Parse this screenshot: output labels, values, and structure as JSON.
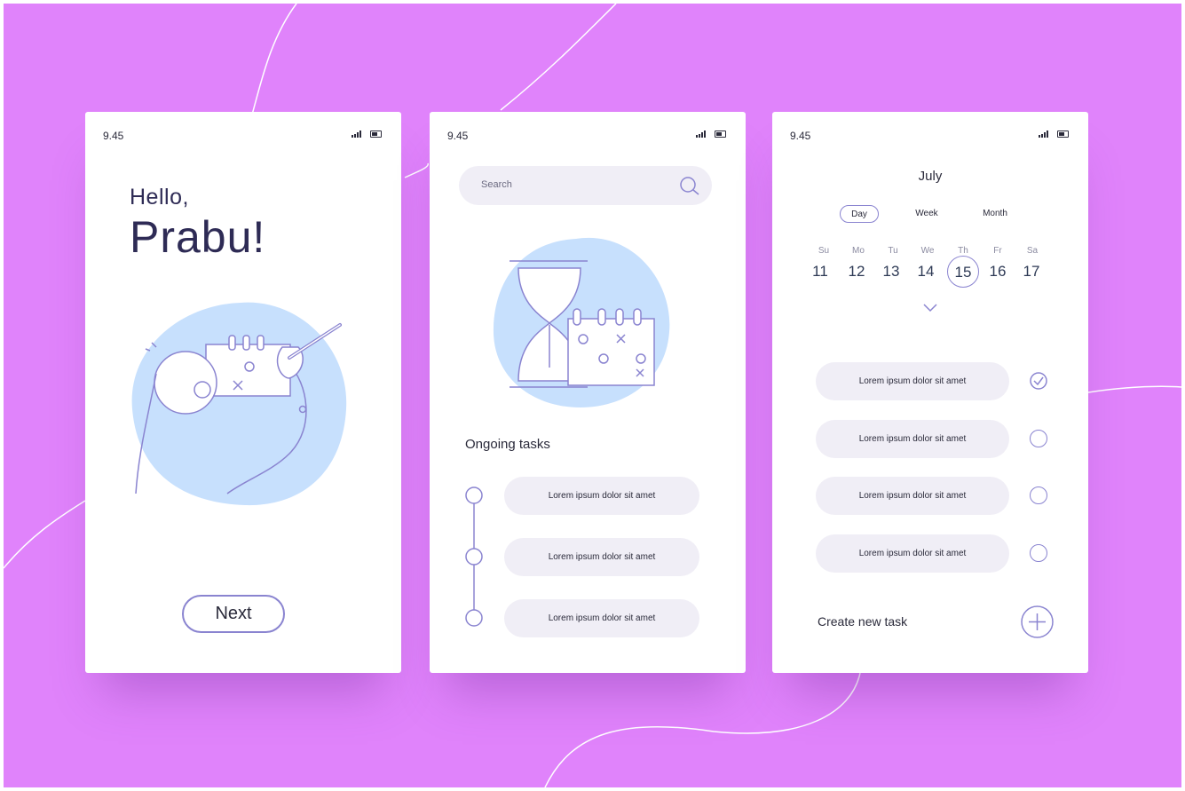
{
  "colors": {
    "background": "#e083fb",
    "accent_outline": "#8a84d0",
    "illustration_blob": "#c7e0fd",
    "pill_fill": "#f0eef6",
    "heading": "#2e2b55"
  },
  "status_bar": {
    "time": "9.45"
  },
  "welcome_screen": {
    "greeting": "Hello,",
    "name": "Prabu!",
    "next_label": "Next"
  },
  "tasks_screen": {
    "search_placeholder": "Search",
    "section_title": "Ongoing tasks",
    "tasks": [
      "Lorem ipsum dolor sit amet",
      "Lorem ipsum dolor sit amet",
      "Lorem ipsum dolor sit amet"
    ]
  },
  "calendar_screen": {
    "month": "July",
    "views": [
      "Day",
      "Week",
      "Month"
    ],
    "active_view": "Day",
    "day_names": [
      "Su",
      "Mo",
      "Tu",
      "We",
      "Th",
      "Fr",
      "Sa"
    ],
    "day_numbers": [
      "11",
      "12",
      "13",
      "14",
      "15",
      "16",
      "17"
    ],
    "selected_day": "15",
    "tasks": [
      {
        "label": "Lorem ipsum dolor sit amet",
        "done": true
      },
      {
        "label": "Lorem ipsum dolor sit amet",
        "done": false
      },
      {
        "label": "Lorem ipsum dolor sit amet",
        "done": false
      },
      {
        "label": "Lorem ipsum dolor sit amet",
        "done": false
      }
    ],
    "create_label": "Create new task"
  }
}
